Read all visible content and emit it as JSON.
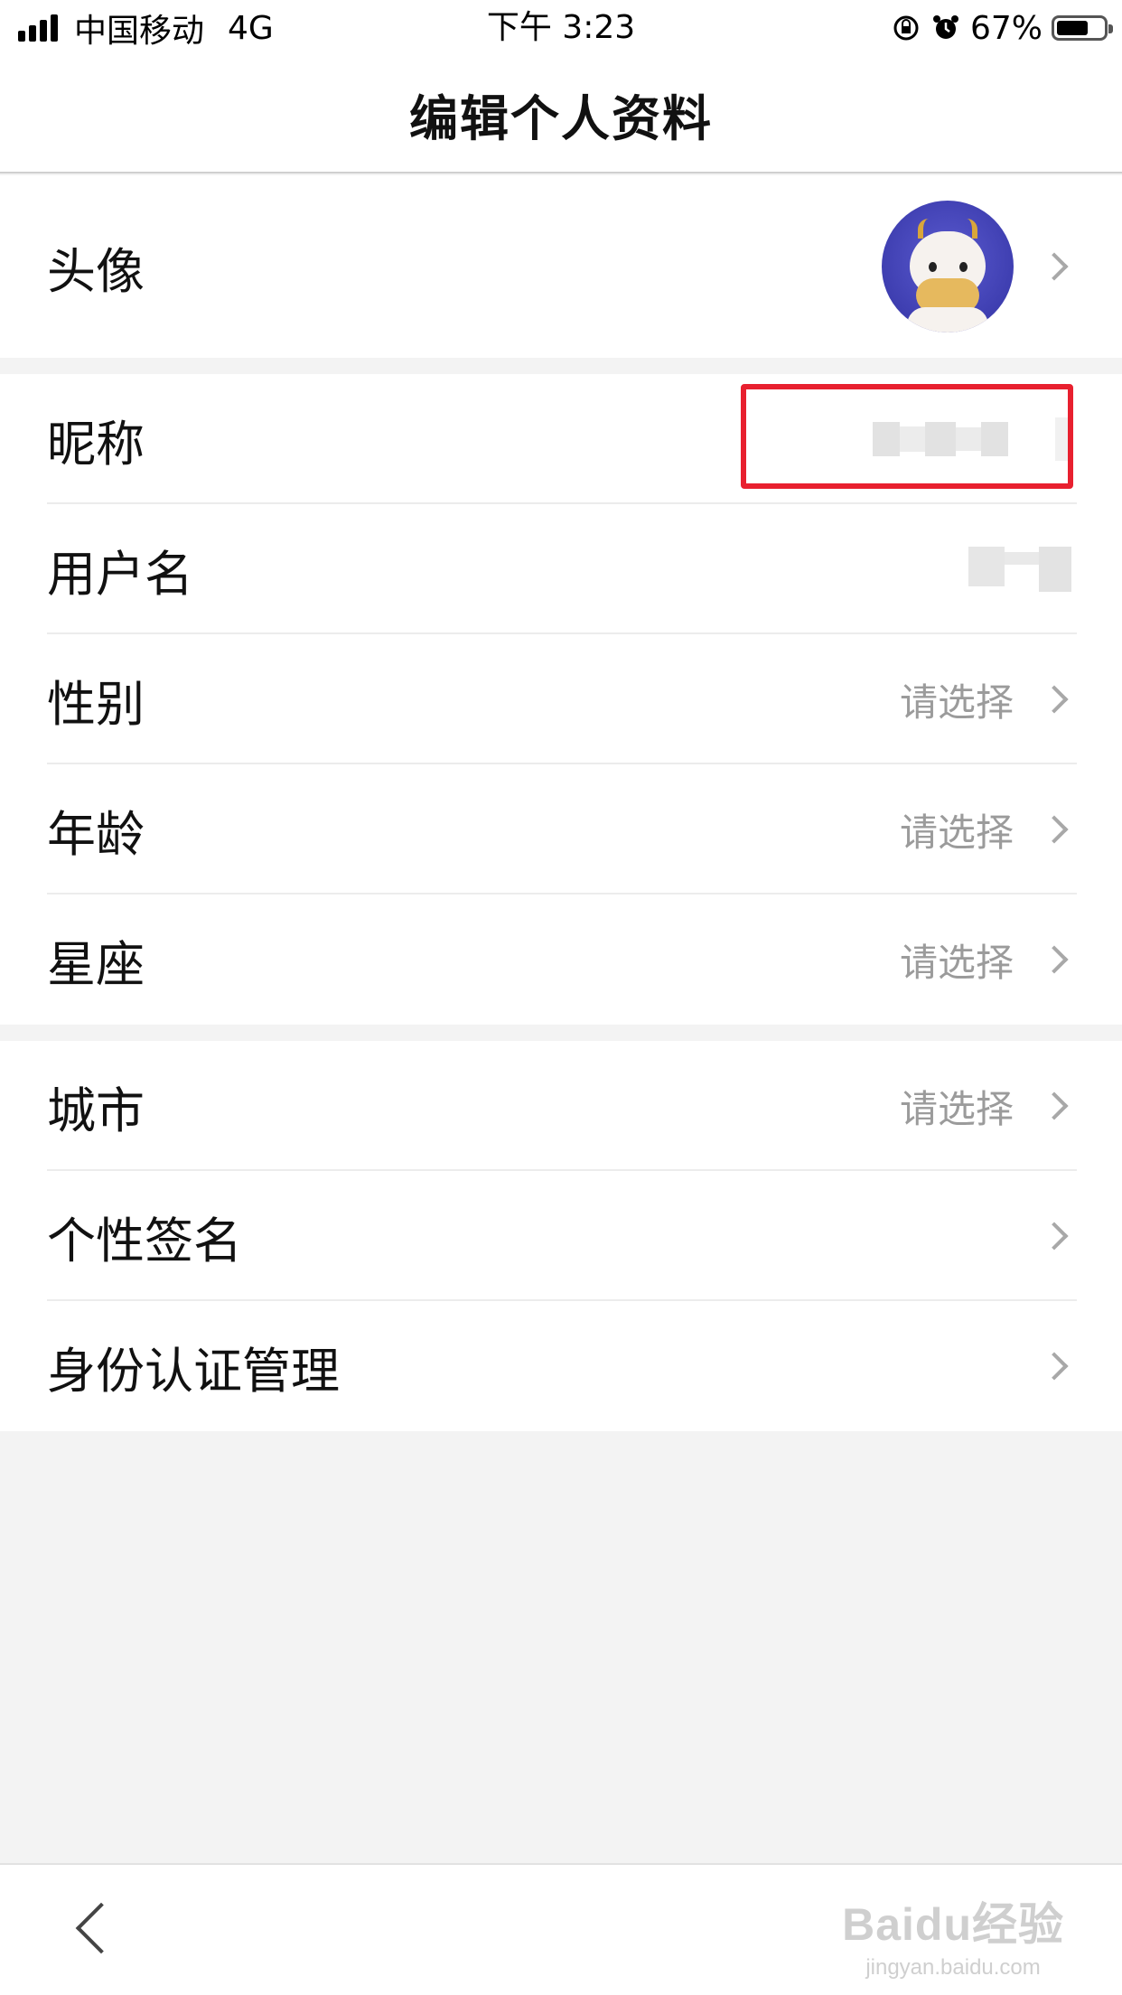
{
  "status_bar": {
    "carrier": "中国移动",
    "network": "4G",
    "time": "下午 3:23",
    "battery": "67%",
    "battery_level": 0.67
  },
  "header": {
    "title": "编辑个人资料"
  },
  "profile": {
    "avatar_label": "头像",
    "items": [
      {
        "label": "昵称"
      },
      {
        "label": "用户名"
      },
      {
        "label": "性别",
        "value": "请选择"
      },
      {
        "label": "年龄",
        "value": "请选择"
      },
      {
        "label": "星座",
        "value": "请选择"
      }
    ],
    "items2": [
      {
        "label": "城市",
        "value": "请选择"
      },
      {
        "label": "个性签名"
      },
      {
        "label": "身份认证管理"
      }
    ]
  },
  "icons": {
    "status": [
      "signal-icon",
      "rotation-lock-icon",
      "alarm-icon",
      "battery-icon"
    ],
    "rows": [
      "chevron-right-icon"
    ],
    "nav": [
      "back-icon"
    ]
  },
  "watermark": {
    "main": "Baidu经验",
    "sub": "jingyan.baidu.com"
  },
  "colors": {
    "highlight": "#e8202f",
    "accent_avatar": "#3e3eb0",
    "value_text": "#9b9b9b"
  }
}
